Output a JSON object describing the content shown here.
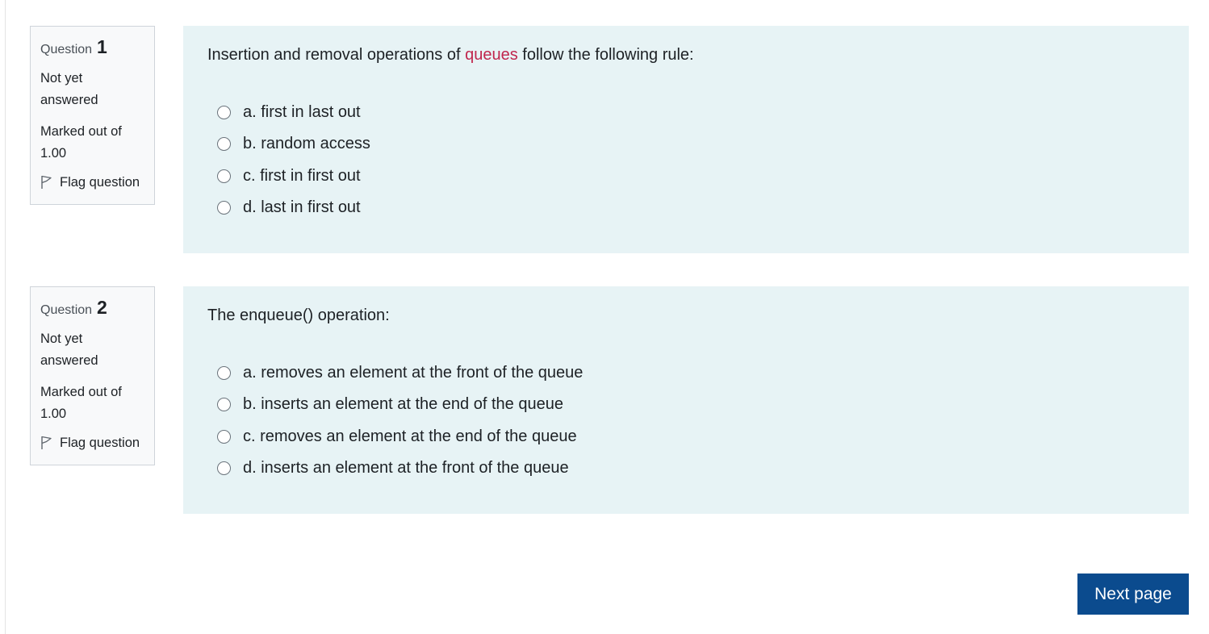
{
  "questions": [
    {
      "label": "Question",
      "number": "1",
      "state": "Not yet answered",
      "grade": "Marked out of 1.00",
      "flag_label": "Flag question",
      "text_before": "Insertion and removal operations of ",
      "text_highlight": "queues",
      "text_after": " follow the following rule:",
      "answers": [
        "a. first in last out",
        "b. random access",
        "c. first in first out",
        "d. last in first out"
      ]
    },
    {
      "label": "Question",
      "number": "2",
      "state": "Not yet answered",
      "grade": "Marked out of 1.00",
      "flag_label": "Flag question",
      "text": "The enqueue() operation:",
      "answers": [
        "a. removes an element at the front of the queue",
        "b. inserts an element at the end of the queue",
        "c. removes an element at the end of the queue",
        "d. inserts an element at the front of the queue"
      ]
    }
  ],
  "navigation": {
    "next_label": "Next page"
  },
  "colors": {
    "info_bg": "#f8f9fa",
    "content_bg": "#e7f3f5",
    "highlight": "#c0264d",
    "button_bg": "#0b4b8e"
  },
  "icons": {
    "flag": "flag-outline-icon",
    "radio": "radio-unchecked"
  }
}
